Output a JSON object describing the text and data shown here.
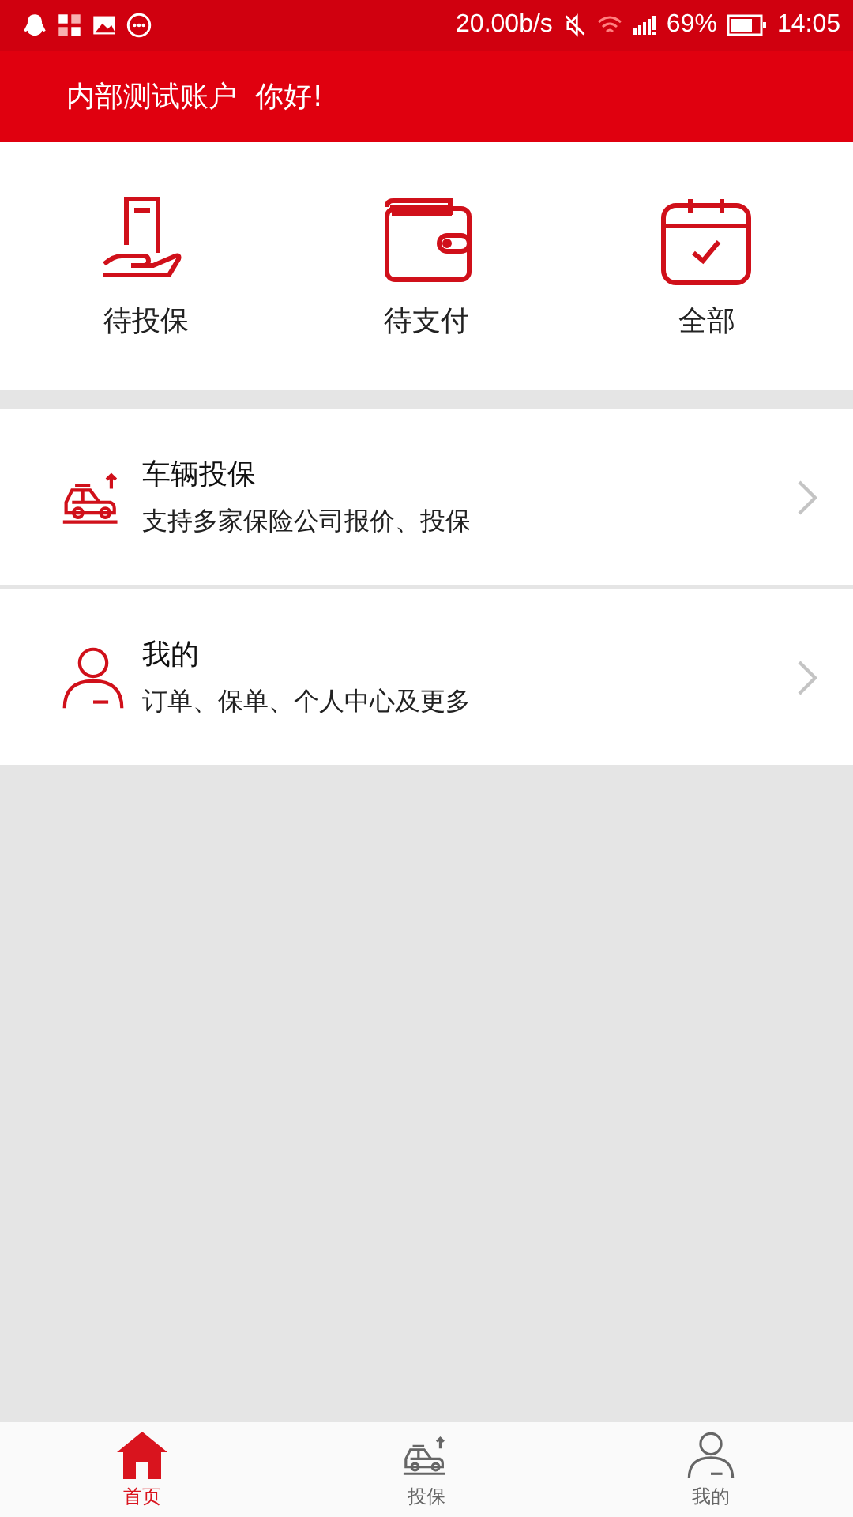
{
  "status_bar": {
    "speed": "20.00b/s",
    "battery": "69%",
    "time": "14:05"
  },
  "header": {
    "title": "内部测试账户  你好!"
  },
  "quick_actions": [
    {
      "label": "待投保"
    },
    {
      "label": "待支付"
    },
    {
      "label": "全部"
    }
  ],
  "menu": [
    {
      "title": "车辆投保",
      "subtitle": "支持多家保险公司报价、投保"
    },
    {
      "title": "我的",
      "subtitle": "订单、保单、个人中心及更多"
    }
  ],
  "tab_bar": [
    {
      "label": "首页",
      "selected": true
    },
    {
      "label": "投保",
      "selected": false
    },
    {
      "label": "我的",
      "selected": false
    }
  ]
}
